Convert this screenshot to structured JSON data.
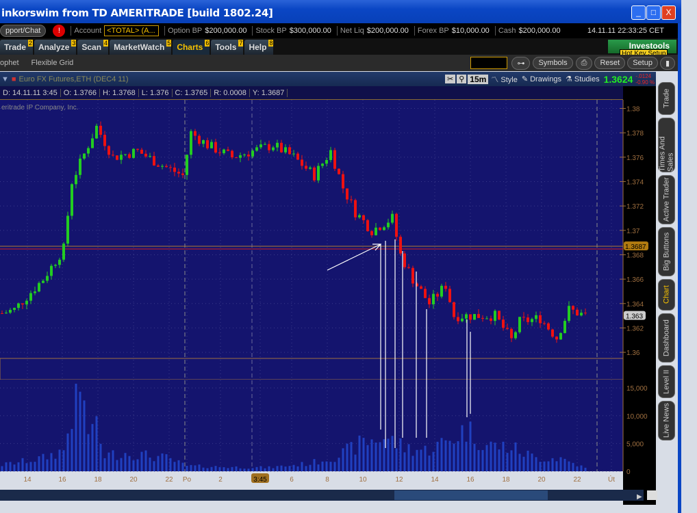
{
  "window": {
    "title": "inkorswim from TD AMERITRADE [build 1802.24]",
    "min": "_",
    "max": "□",
    "close": "X"
  },
  "account_bar": {
    "support": "pport/Chat",
    "alert": "!",
    "account_label": "Account",
    "account_value": "<TOTAL> (A...",
    "option_bp_label": "Option BP",
    "option_bp": "$200,000.00",
    "stock_bp_label": "Stock BP",
    "stock_bp": "$300,000.00",
    "net_liq_label": "Net Liq",
    "net_liq": "$200,000.00",
    "forex_bp_label": "Forex BP",
    "forex_bp": "$10,000.00",
    "cash_label": "Cash",
    "cash": "$200,000.00",
    "datetime": "14.11.11 22:33:25 CET"
  },
  "tabs": [
    {
      "label": "Trade",
      "key": "2"
    },
    {
      "label": "Analyze",
      "key": "3"
    },
    {
      "label": "Scan",
      "key": "4"
    },
    {
      "label": "MarketWatch",
      "key": "5"
    },
    {
      "label": "Charts",
      "key": "6"
    },
    {
      "label": "Tools",
      "key": "7"
    },
    {
      "label": "Help",
      "key": "8"
    }
  ],
  "investools": "Investools",
  "hotkey_tooltip": "Hot Key Setup",
  "subbar": {
    "items": [
      "ophet",
      "Flexible Grid"
    ],
    "symbols": "Symbols",
    "reset": "Reset",
    "setup": "Setup"
  },
  "chart_header": {
    "symbol": "Euro FX Futures,ETH (DEC4 11)",
    "interval": "15m",
    "style": "Style",
    "drawings": "Drawings",
    "studies": "Studies",
    "last": "1.3624",
    "change": "-.0124",
    "change_pct": "-0.90 %"
  },
  "info_row": {
    "d": "D: 14.11.11 3:45",
    "o": "O: 1.3766",
    "h": "H: 1.3768",
    "l": "L: 1.376",
    "c": "C: 1.3765",
    "r": "R: 0.0008",
    "y": "Y: 1.3687"
  },
  "watermark": "eritrade IP Company, Inc.",
  "side_tabs": [
    "Trade",
    "Times And Sales",
    "Active Trader",
    "Big Buttons",
    "Chart",
    "Dashboard",
    "Level II",
    "Live News"
  ],
  "colors": {
    "up": "#22cc22",
    "down": "#ee1111",
    "bg": "#14146e",
    "axis": "#a07040"
  },
  "chart_data": {
    "type": "candlestick",
    "price_axis": {
      "ticks": [
        "1.38",
        "1.378",
        "1.376",
        "1.374",
        "1.372",
        "1.37",
        "1.368",
        "1.366",
        "1.364",
        "1.362",
        "1.36"
      ],
      "range": [
        1.3595,
        1.3807
      ]
    },
    "price_markers": {
      "prev_close": "1.3687",
      "current": "1.363"
    },
    "volume_axis": {
      "ticks": [
        "15,000",
        "10,000",
        "5,000",
        "0"
      ],
      "max": 16500
    },
    "x_ticks": [
      "14",
      "16",
      "18",
      "20",
      "22",
      "Po",
      "2",
      "3:45",
      "6",
      "8",
      "10",
      "12",
      "14",
      "16",
      "18",
      "20",
      "22",
      "Út"
    ],
    "close_keypoints": [
      [
        0,
        1.3632
      ],
      [
        3,
        1.3635
      ],
      [
        10,
        1.366
      ],
      [
        15,
        1.3685
      ],
      [
        17,
        1.374
      ],
      [
        21,
        1.377
      ],
      [
        23,
        1.3785
      ],
      [
        27,
        1.376
      ],
      [
        33,
        1.3765
      ],
      [
        38,
        1.3755
      ],
      [
        44,
        1.3745
      ],
      [
        46,
        1.378
      ],
      [
        50,
        1.377
      ],
      [
        56,
        1.376
      ],
      [
        66,
        1.377
      ],
      [
        71,
        1.376
      ],
      [
        76,
        1.3745
      ],
      [
        80,
        1.3765
      ],
      [
        83,
        1.3735
      ],
      [
        86,
        1.3715
      ],
      [
        90,
        1.37
      ],
      [
        95,
        1.371
      ],
      [
        97,
        1.368
      ],
      [
        100,
        1.366
      ],
      [
        104,
        1.364
      ],
      [
        108,
        1.3655
      ],
      [
        110,
        1.363
      ],
      [
        115,
        1.363
      ],
      [
        120,
        1.363
      ],
      [
        124,
        1.361
      ],
      [
        126,
        1.3625
      ],
      [
        131,
        1.3628
      ],
      [
        135,
        1.3612
      ],
      [
        138,
        1.3635
      ],
      [
        142,
        1.363
      ]
    ],
    "volume_keypoints": [
      [
        0,
        1200
      ],
      [
        10,
        2500
      ],
      [
        15,
        4000
      ],
      [
        17,
        11000
      ],
      [
        20,
        15000
      ],
      [
        21,
        6000
      ],
      [
        22,
        10000
      ],
      [
        25,
        3000
      ],
      [
        30,
        3500
      ],
      [
        40,
        2500
      ],
      [
        45,
        1000
      ],
      [
        55,
        800
      ],
      [
        65,
        700
      ],
      [
        75,
        1500
      ],
      [
        82,
        3000
      ],
      [
        88,
        5500
      ],
      [
        93,
        6500
      ],
      [
        98,
        4500
      ],
      [
        103,
        4000
      ],
      [
        108,
        5500
      ],
      [
        113,
        8000
      ],
      [
        118,
        5000
      ],
      [
        124,
        4500
      ],
      [
        130,
        2500
      ],
      [
        136,
        2500
      ],
      [
        142,
        600
      ]
    ]
  }
}
